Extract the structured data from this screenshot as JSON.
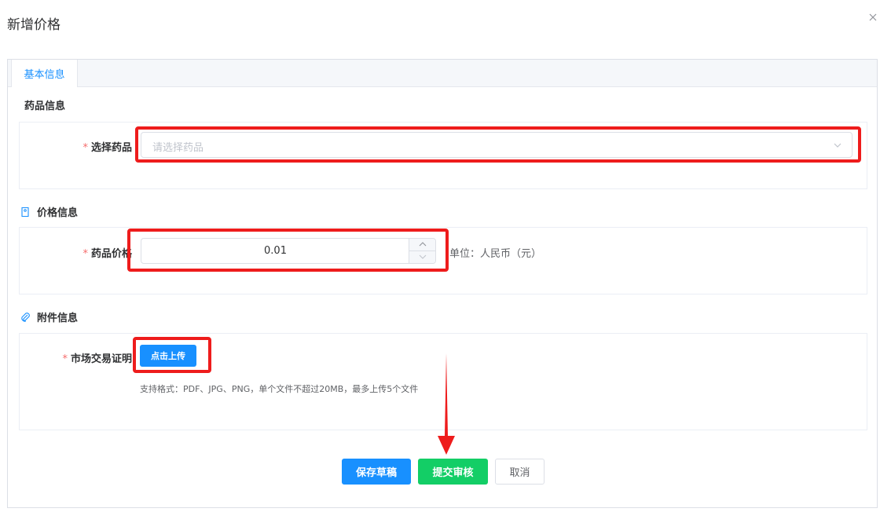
{
  "dialog": {
    "title": "新增价格",
    "close_icon": "close-icon"
  },
  "tabs": [
    {
      "label": "基本信息",
      "active": true
    }
  ],
  "drug_section": {
    "title": "药品信息",
    "select_label": "选择药品",
    "select_placeholder": "请选择药品"
  },
  "price_section": {
    "title": "价格信息",
    "icon": "price-tag-icon",
    "price_label": "药品价格",
    "price_value": "0.01",
    "unit_text": "单位：人民币（元）"
  },
  "attachment_section": {
    "title": "附件信息",
    "icon": "paperclip-icon",
    "proof_label": "市场交易证明",
    "upload_label": "点击上传",
    "hint": "支持格式：PDF、JPG、PNG，单个文件不超过20MB，最多上传5个文件"
  },
  "required_mark": "*",
  "actions": {
    "save_draft": "保存草稿",
    "submit_review": "提交审核",
    "cancel": "取消"
  },
  "colors": {
    "primary": "#1890ff",
    "success": "#13ce66",
    "highlight": "#ee1c1c",
    "required": "#f56c6c"
  }
}
